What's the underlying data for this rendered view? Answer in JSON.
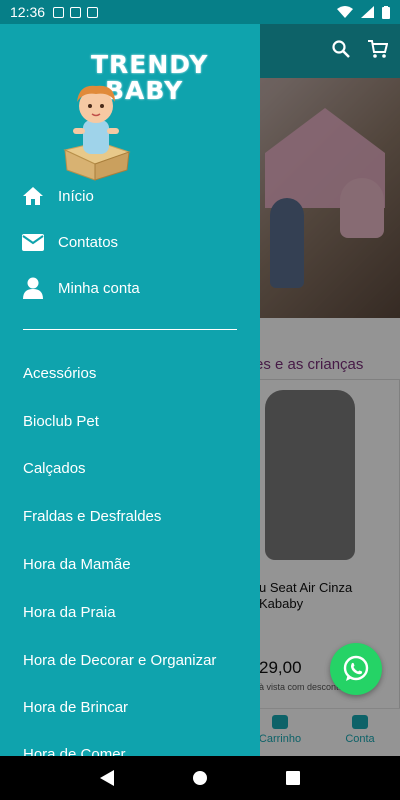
{
  "status_bar": {
    "time": "12:36"
  },
  "drawer": {
    "logo": {
      "line1": "TRENDY",
      "line2": "BABY"
    },
    "main_menu": [
      {
        "label": "Início",
        "icon": "home-icon"
      },
      {
        "label": "Contatos",
        "icon": "envelope-icon"
      },
      {
        "label": "Minha conta",
        "icon": "user-icon"
      }
    ],
    "categories": [
      "Acessórios",
      "Bioclub Pet",
      "Calçados",
      "Fraldas e Desfraldes",
      "Hora da Mamãe",
      "Hora da Praia",
      "Hora de  Decorar e Organizar",
      "Hora de Brincar",
      "Hora de Comer"
    ]
  },
  "background": {
    "section_title": "es e as crianças",
    "product": {
      "name": "u Seat Air Cinza Kababy",
      "price": "29,00",
      "note": "à vista com desconto"
    },
    "bottom_nav": [
      {
        "label": "Carrinho"
      },
      {
        "label": "Conta"
      }
    ]
  },
  "colors": {
    "drawer_bg": "#0fa3ad",
    "status_bar": "#067f88",
    "whatsapp": "#25d366"
  }
}
